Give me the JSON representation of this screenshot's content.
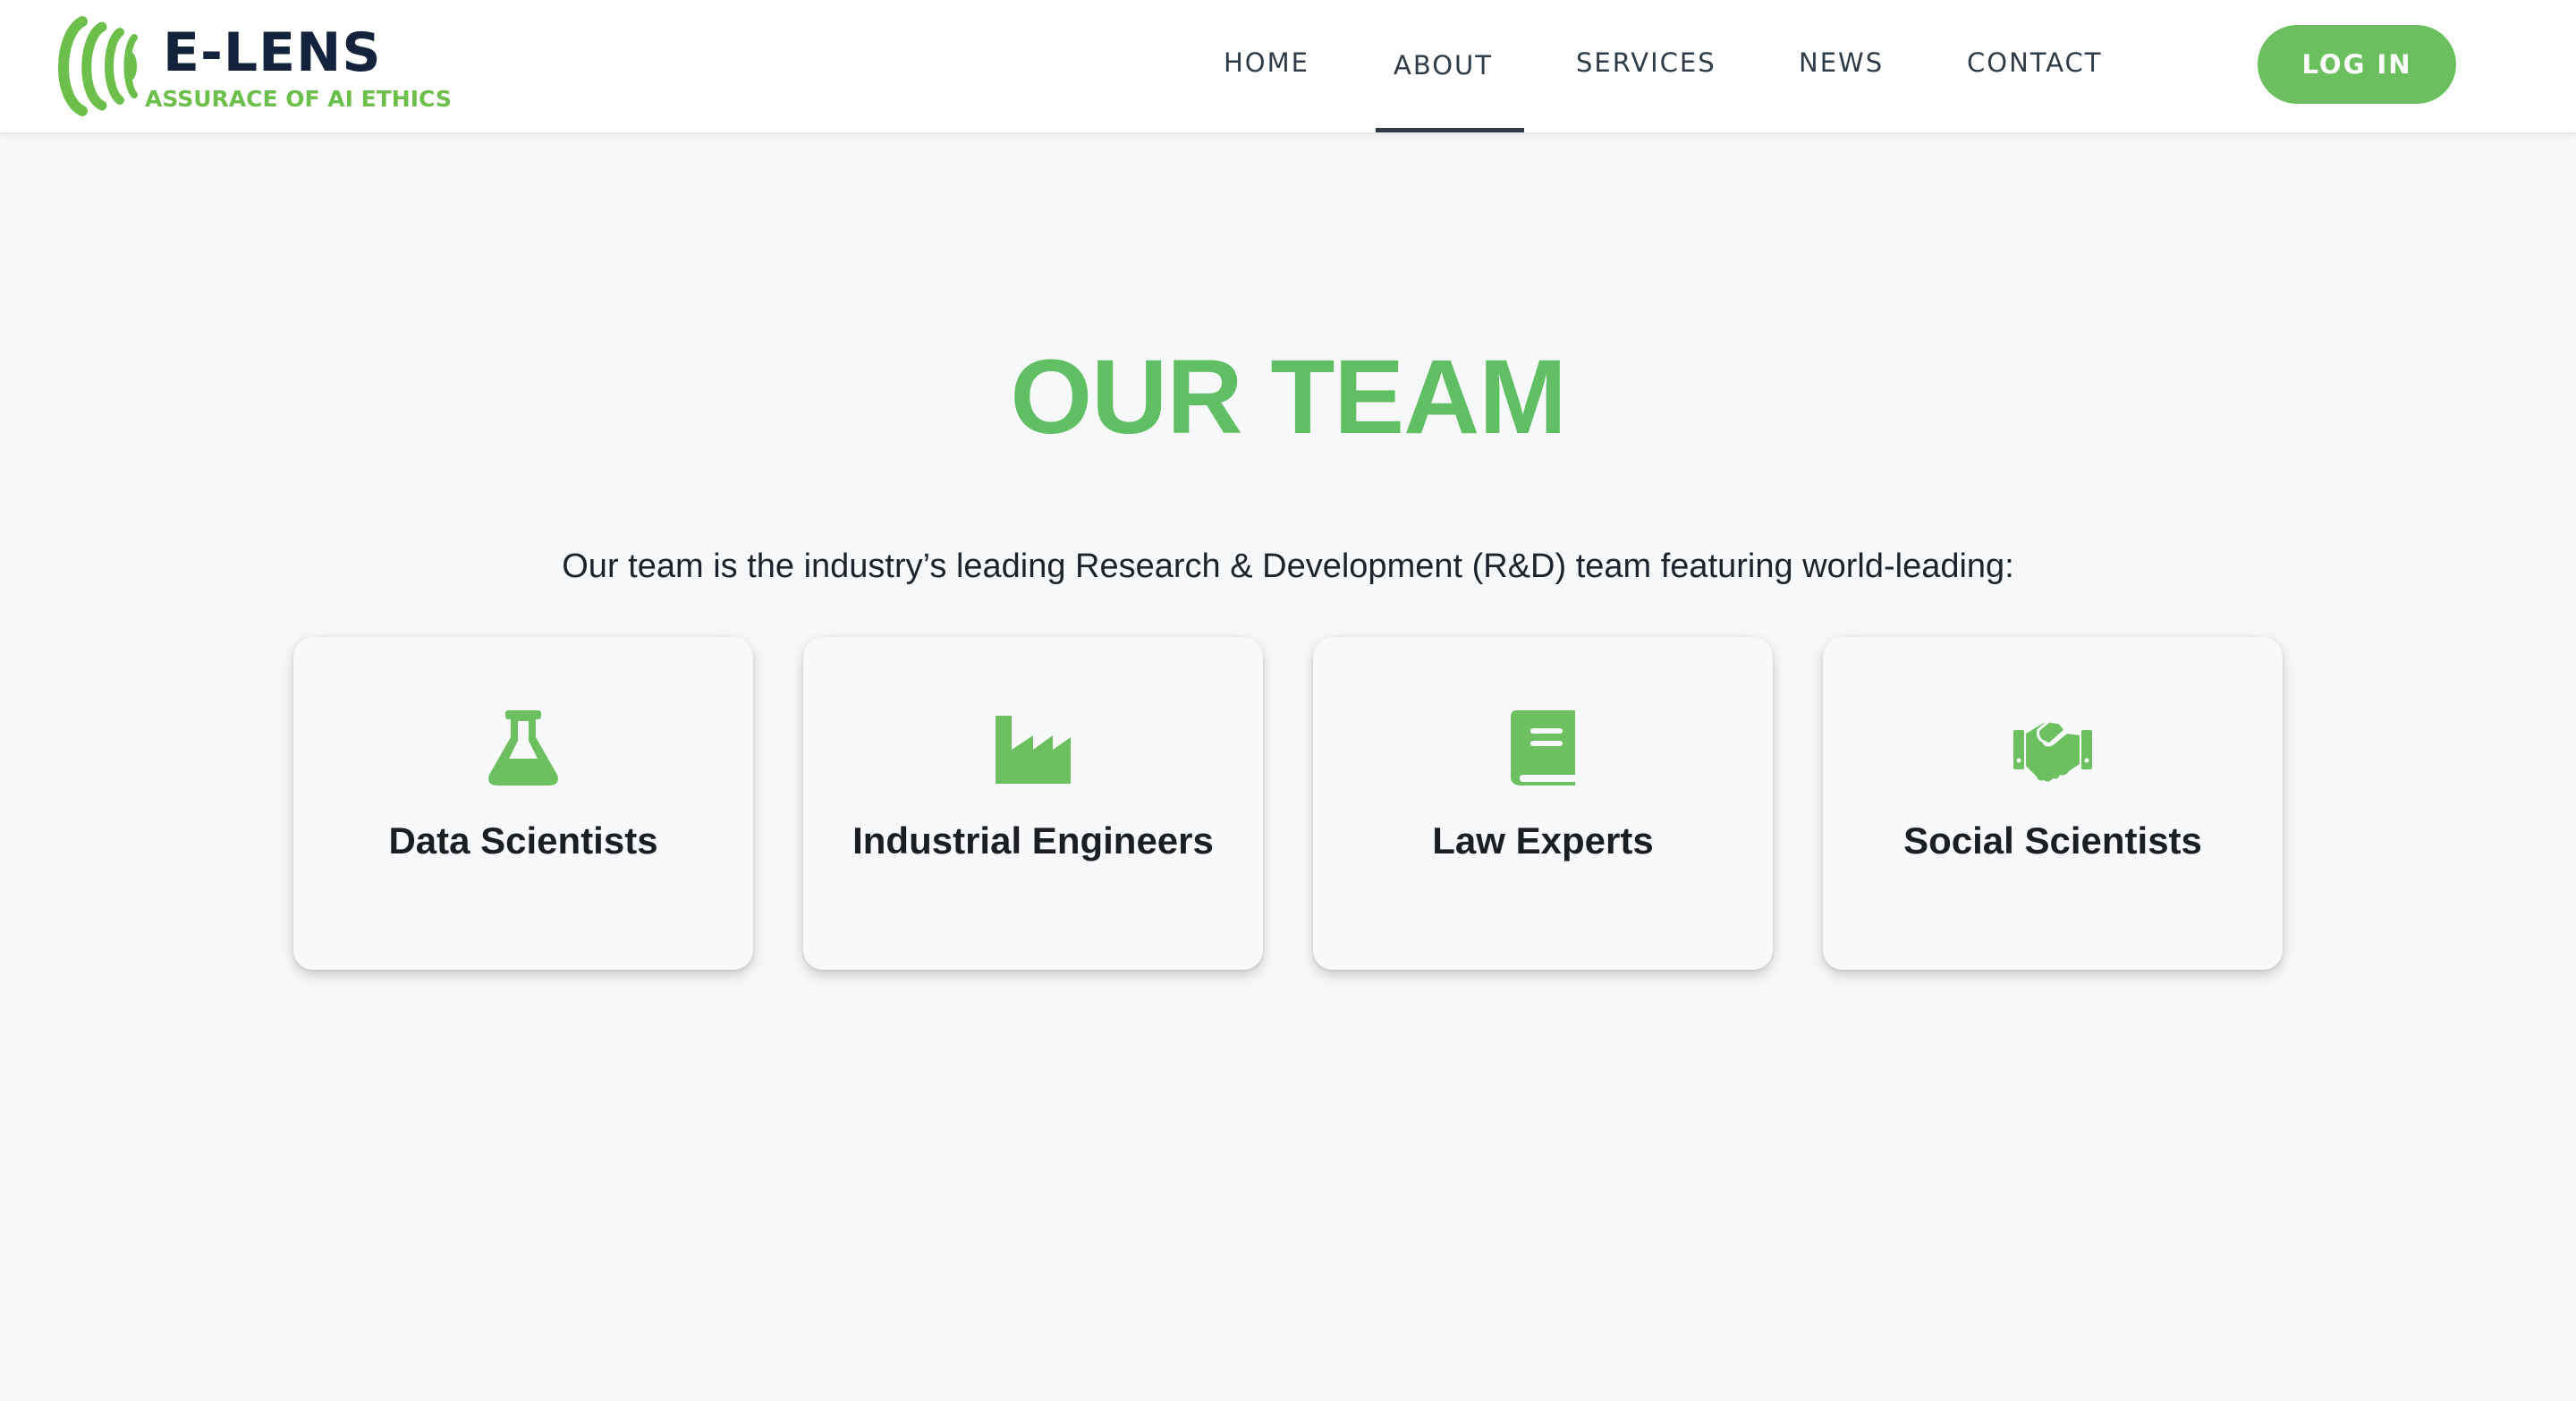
{
  "header": {
    "logo": {
      "name": "E-LENS",
      "tagline": "ASSURACE OF AI ETHICS"
    },
    "nav": [
      {
        "label": "HOME",
        "active": false
      },
      {
        "label": "ABOUT",
        "active": true
      },
      {
        "label": "SERVICES",
        "active": false
      },
      {
        "label": "NEWS",
        "active": false
      },
      {
        "label": "CONTACT",
        "active": false
      }
    ],
    "login_label": "LOG IN"
  },
  "main": {
    "title": "OUR TEAM",
    "subtitle": "Our team is the industry’s leading Research & Development (R&D) team featuring world-leading:",
    "cards": [
      {
        "label": "Data Scientists",
        "icon": "flask-icon"
      },
      {
        "label": "Industrial Engineers",
        "icon": "factory-icon"
      },
      {
        "label": "Law Experts",
        "icon": "book-icon"
      },
      {
        "label": "Social Scientists",
        "icon": "handshake-icon"
      }
    ]
  },
  "colors": {
    "accent_green": "#5fbf62",
    "logo_navy": "#14233c",
    "nav_text": "#2f3b46",
    "page_bg": "#f7f8fa"
  }
}
